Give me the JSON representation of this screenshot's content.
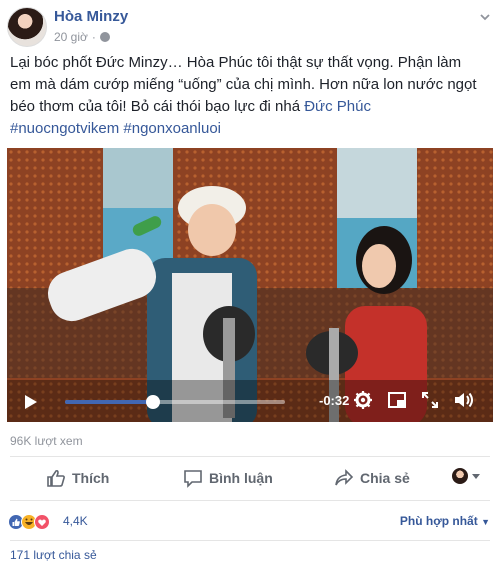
{
  "post": {
    "author": "Hòa Minzy",
    "time": "20 giờ",
    "text_part1": "Lại bóc phốt Đức Minzy… Hòa Phúc tôi thật sự thất vọng. Phận làm em mà dám cướp miếng “uống” của chị mình. Hơn nữa lon nước ngọt béo thơm của tôi! Bỏ cái thói bạo lực đi nhá ",
    "mention": "Đức Phúc",
    "hashtags": "#nuocngotvikem #ngonxoanluoi"
  },
  "video": {
    "remaining_time": "-0:32",
    "progress_fraction": 0.4
  },
  "stats": {
    "views": "96K lượt xem"
  },
  "actions": {
    "like": "Thích",
    "comment": "Bình luận",
    "share": "Chia sẻ"
  },
  "reactions": {
    "count": "4,4K",
    "sort": "Phù hợp nhất",
    "icons": [
      "like-icon",
      "haha-icon",
      "love-icon"
    ]
  },
  "shares": {
    "label": "171 lượt chia sẻ"
  },
  "colors": {
    "link": "#365899",
    "accent": "#4267b2",
    "muted": "#90949c"
  }
}
